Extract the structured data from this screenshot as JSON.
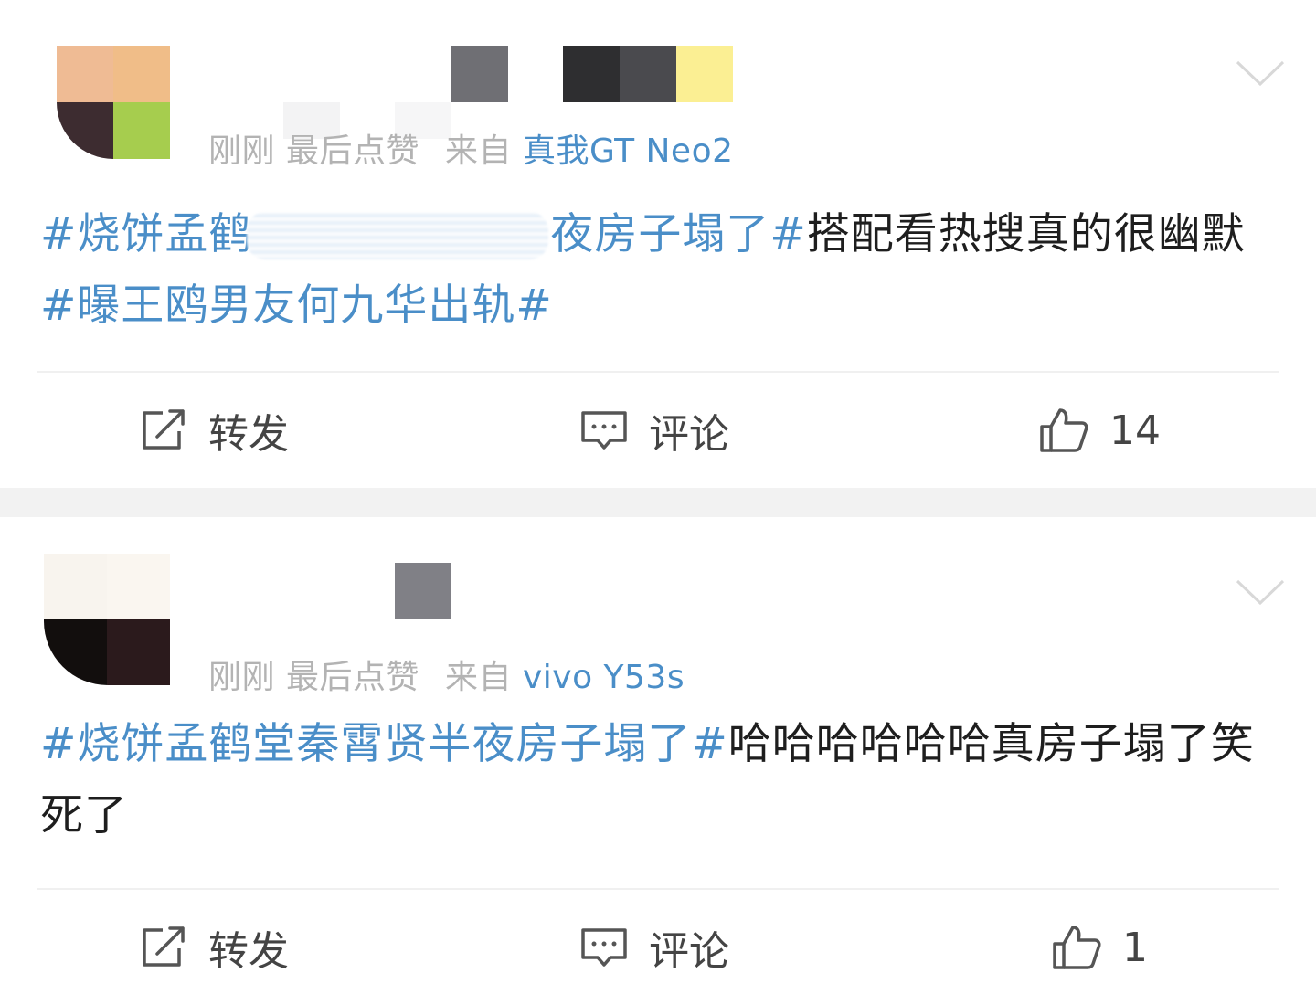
{
  "posts": [
    {
      "time": "刚刚",
      "status": "最后点赞",
      "source_prefix": "来自",
      "device": "真我GT Neo2",
      "content_topic1": "#烧饼孟鹤",
      "content_topic1_tail": "夜房子塌了#",
      "content_text": "搭配看热搜真的很幽默",
      "content_topic2": "#曝王鸥男友何九华出轨#",
      "content_text2": "",
      "actions": {
        "repost": "转发",
        "comment": "评论",
        "likes": "14"
      }
    },
    {
      "time": "刚刚",
      "status": "最后点赞",
      "source_prefix": "来自",
      "device": "vivo Y53s",
      "content_topic1": "#烧饼孟鹤堂秦霄贤半夜房子塌了#",
      "content_text": "哈哈哈哈哈哈真房子塌了笑死了",
      "actions": {
        "repost": "转发",
        "comment": "评论",
        "likes": "1"
      }
    }
  ],
  "icons": {
    "repost": "repost-icon",
    "comment": "comment-icon",
    "like": "thumbs-up-icon",
    "more": "chevron-down-icon"
  },
  "colors": {
    "link": "#4a8ec8",
    "meta": "#b3b3b3",
    "text": "#1e1e1e",
    "separator": "#f2f2f2"
  }
}
